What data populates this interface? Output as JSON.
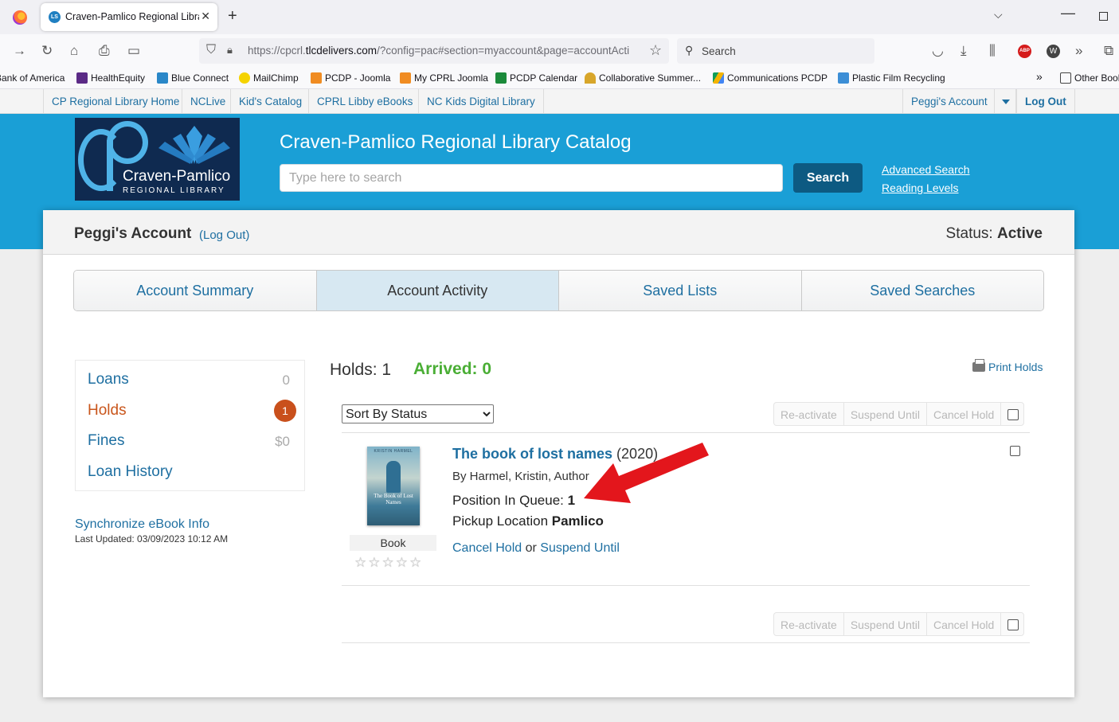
{
  "browser": {
    "tab_title": "Craven-Pamlico Regional Librar",
    "tab_close": "✕",
    "favicon": "LS",
    "url_prefix": "https://cpcrl.",
    "url_domain": "tlcdelivers.com",
    "url_rest": "/?config=pac#section=myaccount&page=accountActi",
    "search_placeholder": "Search"
  },
  "bookmarks": [
    {
      "label": "Bank of America"
    },
    {
      "label": "HealthEquity"
    },
    {
      "label": "Blue Connect"
    },
    {
      "label": "MailChimp"
    },
    {
      "label": "PCDP - Joomla"
    },
    {
      "label": "My CPRL Joomla"
    },
    {
      "label": "PCDP Calendar"
    },
    {
      "label": "Collaborative Summer..."
    },
    {
      "label": "Communications PCDP"
    },
    {
      "label": "Plastic Film Recycling"
    },
    {
      "label": "Other Bookmarks"
    }
  ],
  "sitelinks": {
    "home": "CP Regional Library Home",
    "nclive": "NCLive",
    "kids": "Kid's Catalog",
    "libby": "CPRL Libby eBooks",
    "nckids": "NC Kids Digital Library",
    "account": "Peggi's Account",
    "logout": "Log Out"
  },
  "header": {
    "logo_name": "Craven-Pamlico",
    "logo_sub": "REGIONAL LIBRARY",
    "catalog_title": "Craven-Pamlico Regional Library Catalog",
    "search_placeholder": "Type here to search",
    "search_button": "Search",
    "advanced_search": "Advanced Search",
    "reading_levels": "Reading Levels"
  },
  "account": {
    "name": "Peggi's Account",
    "logout": "(Log Out)",
    "status_label": "Status: ",
    "status_value": "Active",
    "tabs": [
      {
        "label": "Account Summary"
      },
      {
        "label": "Account Activity"
      },
      {
        "label": "Saved Lists"
      },
      {
        "label": "Saved Searches"
      }
    ]
  },
  "side_menu": {
    "loans": "Loans",
    "loans_count": "0",
    "holds": "Holds",
    "holds_count": "1",
    "fines": "Fines",
    "fines_count": "$0",
    "loan_history": "Loan History",
    "sync": "Synchronize eBook Info",
    "last_updated": "Last Updated: 03/09/2023 10:12 AM"
  },
  "holds": {
    "count_label": "Holds: 1",
    "arrived_label": "Arrived: 0",
    "print": "Print Holds",
    "sort_selected": "Sort By Status",
    "actions": {
      "reactivate": "Re-activate",
      "suspend": "Suspend Until",
      "cancel": "Cancel Hold"
    },
    "item": {
      "title": "The book of lost names",
      "year": "(2020)",
      "author": "By Harmel, Kristin, Author",
      "queue_label": "Position In Queue: ",
      "queue_value": "1",
      "pickup_label": "Pickup Location ",
      "pickup_value": "Pamlico",
      "cancel_link": "Cancel Hold",
      "or": " or ",
      "suspend_link": "Suspend Until",
      "format": "Book",
      "cover_author": "KRISTIN HARMEL",
      "cover_title": "The Book of Lost Names",
      "rating": "☆☆☆☆☆"
    }
  }
}
